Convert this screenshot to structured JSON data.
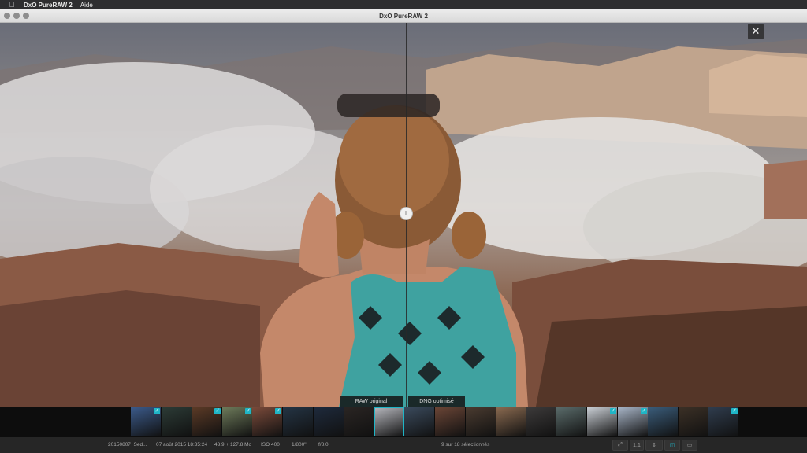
{
  "menubar": {
    "apple_icon": "apple-icon",
    "app_name": "DxO PureRAW 2",
    "menu_help": "Aide"
  },
  "window": {
    "title": "DxO PureRAW 2"
  },
  "viewer": {
    "close_glyph": "✕",
    "handle_glyph": "‖",
    "label_left": "RAW original",
    "label_right": "DNG optimisé"
  },
  "filmstrip": {
    "thumbnails": [
      {
        "color": "#3b5a8a",
        "checked": true
      },
      {
        "color": "#2c3b36",
        "checked": false
      },
      {
        "color": "#5b3a26",
        "checked": true
      },
      {
        "color": "#6d7a5a",
        "checked": true
      },
      {
        "color": "#7a4a3a",
        "checked": true
      },
      {
        "color": "#243444",
        "checked": false
      },
      {
        "color": "#1e2a3c",
        "checked": false
      },
      {
        "color": "#2a2523",
        "checked": false
      },
      {
        "color": "#b7b8be",
        "checked": false
      },
      {
        "color": "#3a4a5c",
        "checked": false
      },
      {
        "color": "#6a4536",
        "checked": false
      },
      {
        "color": "#4a3b30",
        "checked": false
      },
      {
        "color": "#8a6a50",
        "checked": false
      },
      {
        "color": "#3c3a3a",
        "checked": false
      },
      {
        "color": "#5a6b6a",
        "checked": false
      },
      {
        "color": "#c9ced4",
        "checked": true
      },
      {
        "color": "#a7b4c6",
        "checked": true
      },
      {
        "color": "#3a5c7a",
        "checked": false
      },
      {
        "color": "#3b3026",
        "checked": false
      },
      {
        "color": "#2f3c4d",
        "checked": true
      }
    ]
  },
  "status": {
    "filename": "20150807_Sed...",
    "date": "07 août 2015 18:35:24",
    "size": "43.9 + 127.8 Mo",
    "iso": "ISO 400",
    "shutter": "1/800\"",
    "aperture": "f/8.0",
    "selection": "9 sur 18 sélectionnés",
    "zoom": "1:1"
  },
  "colors": {
    "accent": "#1fb5c6"
  }
}
